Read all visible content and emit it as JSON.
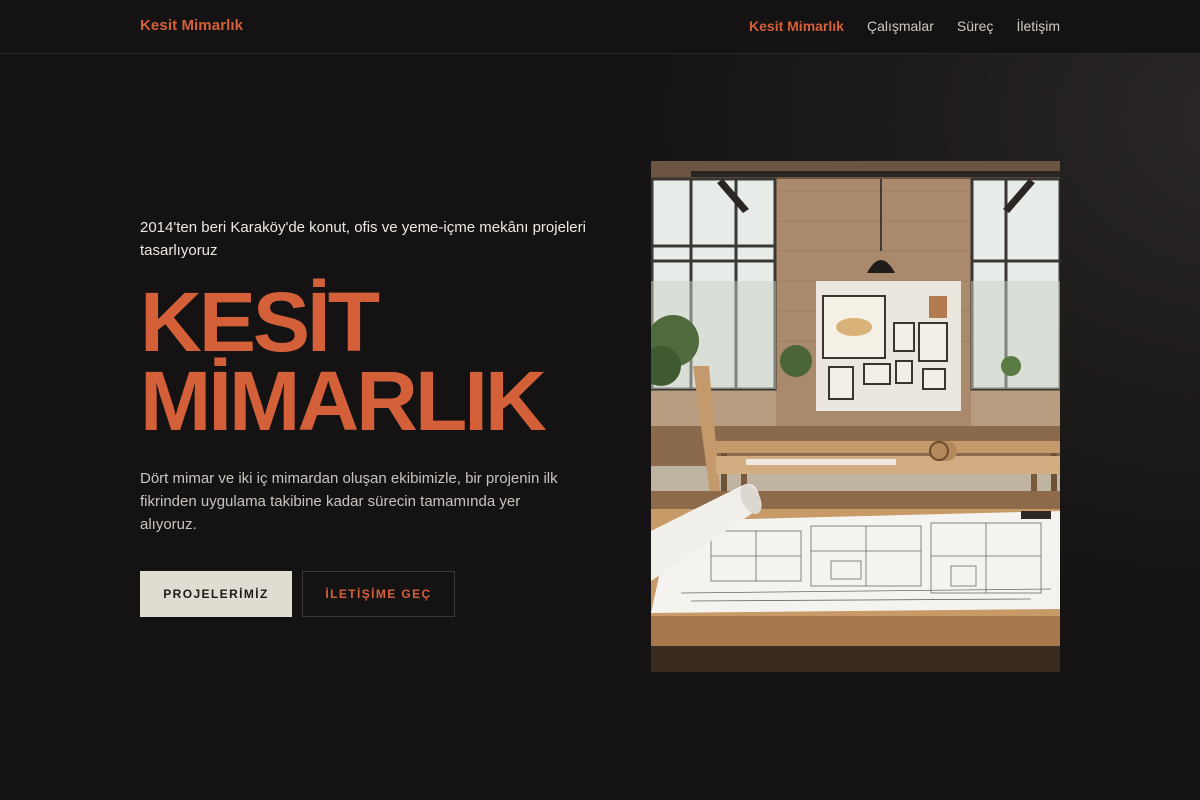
{
  "header": {
    "brand": "Kesit Mimarlık",
    "nav": [
      {
        "label": "Kesit Mimarlık",
        "active": true
      },
      {
        "label": "Çalışmalar",
        "active": false
      },
      {
        "label": "Süreç",
        "active": false
      },
      {
        "label": "İletişim",
        "active": false
      }
    ]
  },
  "hero": {
    "kicker": "2014'ten beri Karaköy'de konut, ofis ve yeme-içme mekânı projeleri tasarlıyoruz",
    "title_line1": "KESİT",
    "title_line2": "MİMARLIK",
    "description": "Dört mimar ve iki iç mimardan oluşan ekibimizle, bir projenin ilk fikrinden uygulama takibine kadar sürecin tamamında yer alıyoruz.",
    "primary_button": "PROJELERİMİZ",
    "secondary_button": "İLETİŞİME GEÇ"
  },
  "image": {
    "alt": "Architecture studio interior with drafting tables and blueprints"
  },
  "colors": {
    "accent": "#d4603a",
    "background": "#141212",
    "button_light": "#e1dcd1"
  }
}
